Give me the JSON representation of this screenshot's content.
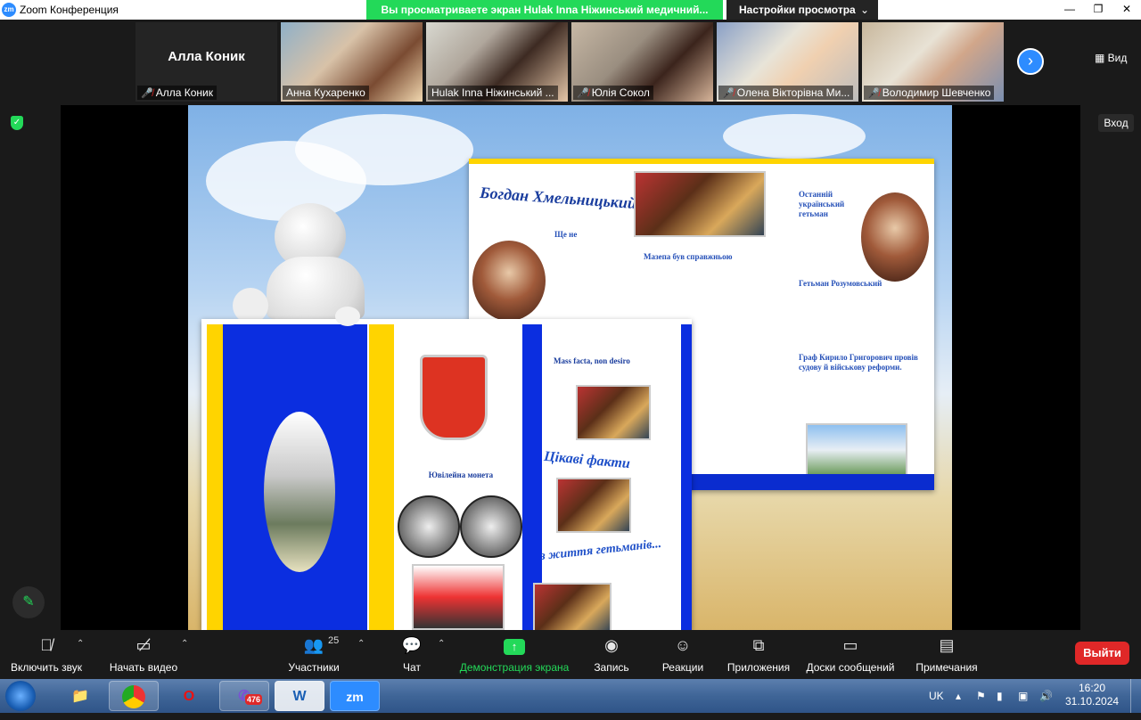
{
  "window": {
    "logo": "zm",
    "title": "Zoom Конференция",
    "share_banner": "Вы просматриваете экран Hulak Inna Ніжинський медичний...",
    "view_settings": "Настройки просмотра",
    "controls": [
      "—",
      "❐",
      "✕"
    ]
  },
  "participants": [
    {
      "name": "Алла Коник",
      "muted": true,
      "video": false
    },
    {
      "name": "Анна Кухаренко",
      "muted": false,
      "video": true
    },
    {
      "name": "Hulak Inna Ніжинський ...",
      "muted": false,
      "video": true,
      "active": true
    },
    {
      "name": "Юлія Сокол",
      "muted": true,
      "video": true
    },
    {
      "name": "Олена Вікторівна Ми...",
      "muted": true,
      "video": true
    },
    {
      "name": "Володимир Шевченко",
      "muted": true,
      "video": true
    }
  ],
  "strip": {
    "view_label": "Вид"
  },
  "side": {
    "enter_label": "Вход"
  },
  "slide": {
    "right_title": "Богдан Хмельницький",
    "right_texts": [
      "Ще не",
      "Мазепа був справжньою",
      "Останній український гетьман",
      "Гетьман Розумовський",
      "Граф Кирило Григорович провів судову й військову реформи."
    ],
    "left_texts": [
      "Mass facta, non desiro",
      "Цікаві факти",
      "з життя гетьманів...",
      "Ювілейна монета"
    ]
  },
  "toolbar": {
    "items": [
      {
        "icon": "mic-off-icon",
        "label": "Включить звук"
      },
      {
        "icon": "video-off-icon",
        "label": "Начать видео"
      },
      {
        "icon": "participants-icon",
        "label": "Участники",
        "count": "25"
      },
      {
        "icon": "chat-icon",
        "label": "Чат"
      },
      {
        "icon": "share-screen-icon",
        "label": "Демонстрация экрана"
      },
      {
        "icon": "record-icon",
        "label": "Запись"
      },
      {
        "icon": "reactions-icon",
        "label": "Реакции"
      },
      {
        "icon": "apps-icon",
        "label": "Приложения"
      },
      {
        "icon": "whiteboard-icon",
        "label": "Доски сообщений"
      },
      {
        "icon": "notes-icon",
        "label": "Примечания"
      }
    ],
    "leave_label": "Выйти"
  },
  "taskbar": {
    "apps": [
      "explorer",
      "chrome",
      "opera",
      "viber",
      "word",
      "zoom"
    ],
    "viber_badge": "476",
    "word_label": "W",
    "zoom_label": "zm",
    "lang": "UK",
    "time": "16:20",
    "date": "31.10.2024"
  }
}
